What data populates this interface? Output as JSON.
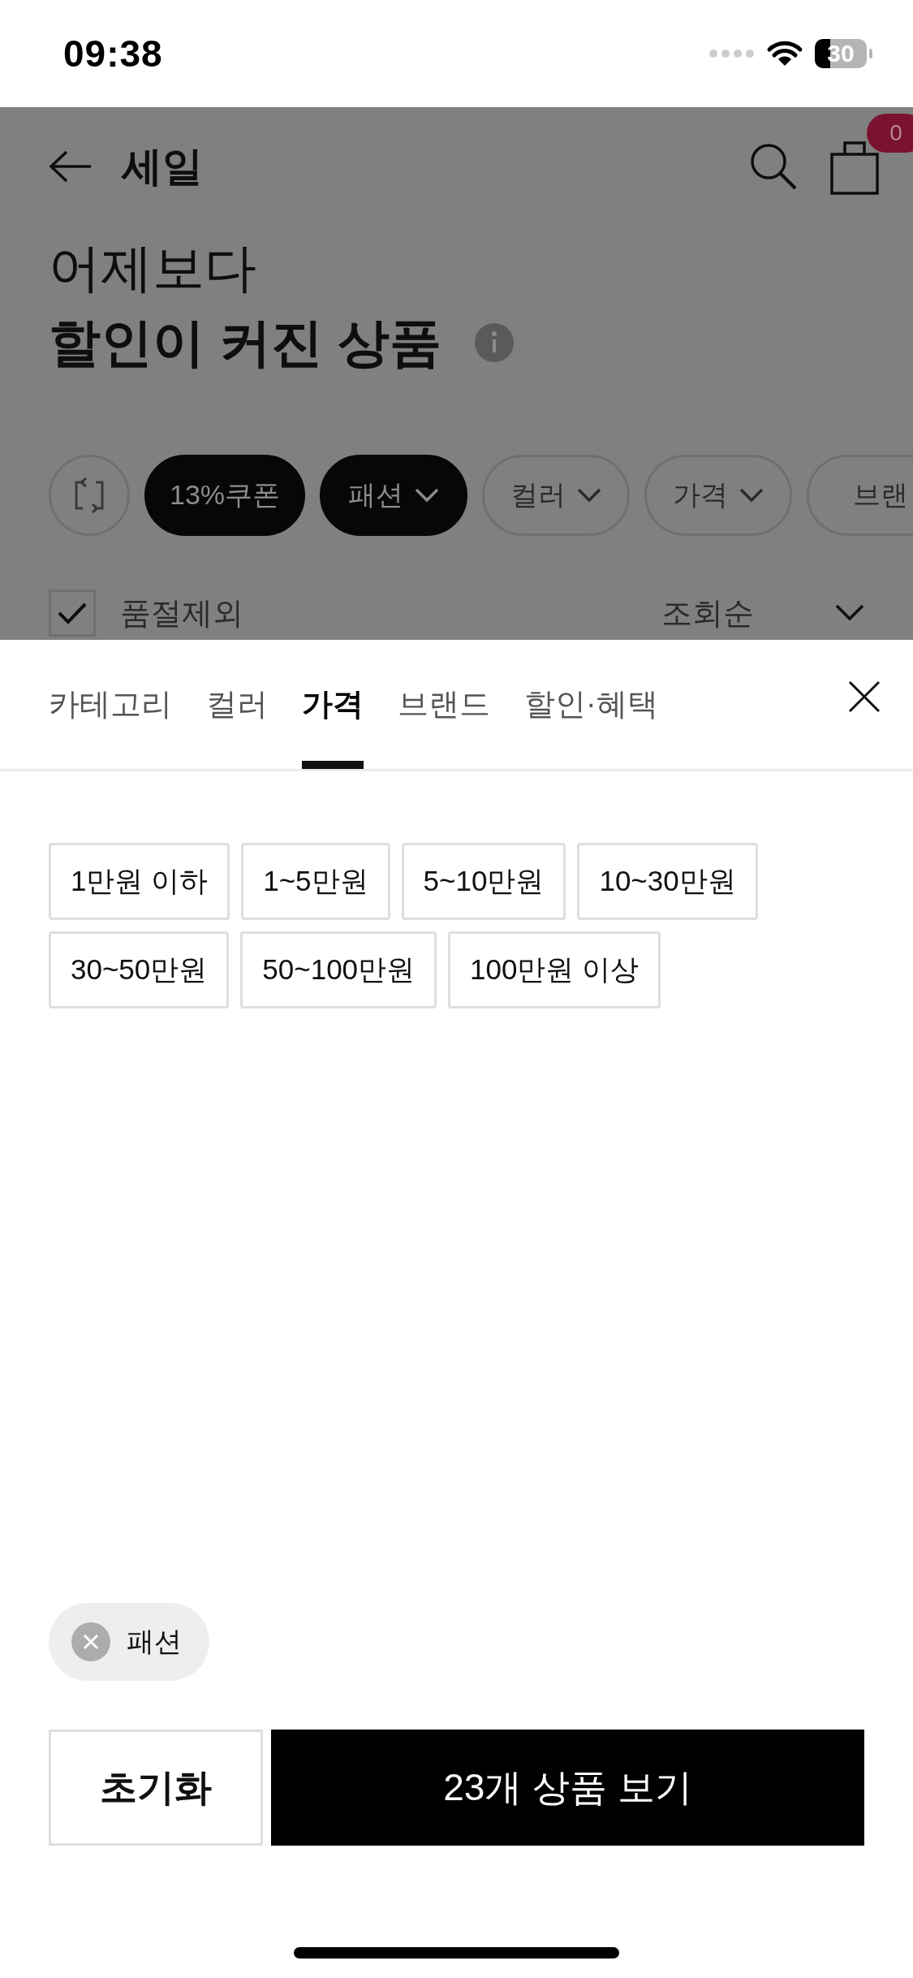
{
  "status_bar": {
    "time": "09:38",
    "battery": "30"
  },
  "header": {
    "title": "세일",
    "cart_badge": "0"
  },
  "headline": {
    "line_1": "어제보다",
    "line_2": "할인이 커진 상품"
  },
  "filter_chips": [
    {
      "label": "13%쿠폰",
      "selected": true,
      "dropdown": false
    },
    {
      "label": "패션",
      "selected": true,
      "dropdown": true
    },
    {
      "label": "컬러",
      "selected": false,
      "dropdown": true
    },
    {
      "label": "가격",
      "selected": false,
      "dropdown": true
    },
    {
      "label": "브랜",
      "selected": false,
      "dropdown": false
    }
  ],
  "exclude_sold_out": {
    "label": "품절제외",
    "checked": true
  },
  "sort": {
    "label": "조회순"
  },
  "sheet_tabs": [
    {
      "label": "카테고리",
      "selected": false
    },
    {
      "label": "컬러",
      "selected": false
    },
    {
      "label": "가격",
      "selected": true
    },
    {
      "label": "브랜드",
      "selected": false
    },
    {
      "label": "할인·혜택",
      "selected": false
    }
  ],
  "price_options": [
    {
      "label": "1만원 이하",
      "selected": false
    },
    {
      "label": "1~5만원",
      "selected": false
    },
    {
      "label": "5~10만원",
      "selected": false
    },
    {
      "label": "10~30만원",
      "selected": false
    },
    {
      "label": "30~50만원",
      "selected": false
    },
    {
      "label": "50~100만원",
      "selected": false
    },
    {
      "label": "100만원 이상",
      "selected": false
    }
  ],
  "applied_filters": [
    {
      "label": "패션"
    }
  ],
  "buttons": {
    "reset": "초기화",
    "apply": "23개 상품 보기"
  }
}
